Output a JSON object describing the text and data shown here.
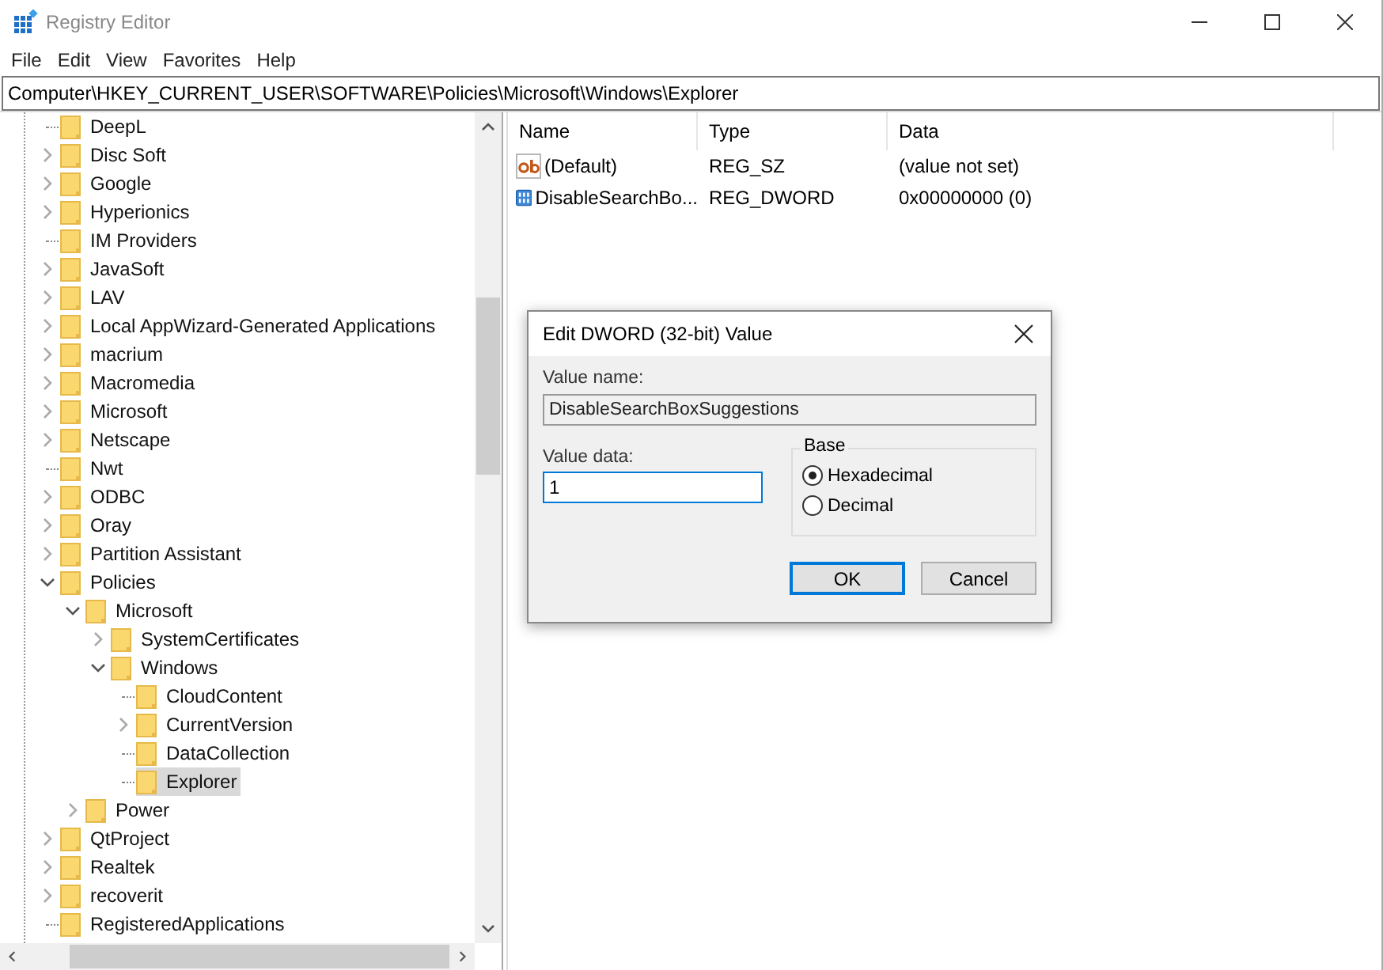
{
  "window": {
    "title": "Registry Editor"
  },
  "menu": [
    "File",
    "Edit",
    "View",
    "Favorites",
    "Help"
  ],
  "address": "Computer\\HKEY_CURRENT_USER\\SOFTWARE\\Policies\\Microsoft\\Windows\\Explorer",
  "tree": [
    {
      "label": "DeepL",
      "expandable": false,
      "selected": false
    },
    {
      "label": "Disc Soft",
      "expandable": true,
      "expanded": false,
      "selected": false
    },
    {
      "label": "Google",
      "expandable": true,
      "expanded": false,
      "selected": false
    },
    {
      "label": "Hyperionics",
      "expandable": true,
      "expanded": false,
      "selected": false
    },
    {
      "label": "IM Providers",
      "expandable": false,
      "selected": false
    },
    {
      "label": "JavaSoft",
      "expandable": true,
      "expanded": false,
      "selected": false
    },
    {
      "label": "LAV",
      "expandable": true,
      "expanded": false,
      "selected": false
    },
    {
      "label": "Local AppWizard-Generated Applications",
      "expandable": true,
      "expanded": false,
      "selected": false
    },
    {
      "label": "macrium",
      "expandable": true,
      "expanded": false,
      "selected": false
    },
    {
      "label": "Macromedia",
      "expandable": true,
      "expanded": false,
      "selected": false
    },
    {
      "label": "Microsoft",
      "expandable": true,
      "expanded": false,
      "selected": false
    },
    {
      "label": "Netscape",
      "expandable": true,
      "expanded": false,
      "selected": false
    },
    {
      "label": "Nwt",
      "expandable": false,
      "selected": false
    },
    {
      "label": "ODBC",
      "expandable": true,
      "expanded": false,
      "selected": false
    },
    {
      "label": "Oray",
      "expandable": true,
      "expanded": false,
      "selected": false
    },
    {
      "label": "Partition Assistant",
      "expandable": true,
      "expanded": false,
      "selected": false
    },
    {
      "label": "Policies",
      "expandable": true,
      "expanded": true,
      "selected": false,
      "children": [
        {
          "label": "Microsoft",
          "expandable": true,
          "expanded": true,
          "selected": false,
          "children": [
            {
              "label": "SystemCertificates",
              "expandable": true,
              "expanded": false,
              "selected": false
            },
            {
              "label": "Windows",
              "expandable": true,
              "expanded": true,
              "selected": false,
              "children": [
                {
                  "label": "CloudContent",
                  "expandable": false,
                  "selected": false
                },
                {
                  "label": "CurrentVersion",
                  "expandable": true,
                  "expanded": false,
                  "selected": false
                },
                {
                  "label": "DataCollection",
                  "expandable": false,
                  "selected": false
                },
                {
                  "label": "Explorer",
                  "expandable": false,
                  "selected": true
                }
              ]
            }
          ]
        },
        {
          "label": "Power",
          "expandable": true,
          "expanded": false,
          "selected": false
        }
      ]
    },
    {
      "label": "QtProject",
      "expandable": true,
      "expanded": false,
      "selected": false
    },
    {
      "label": "Realtek",
      "expandable": true,
      "expanded": false,
      "selected": false
    },
    {
      "label": "recoverit",
      "expandable": true,
      "expanded": false,
      "selected": false
    },
    {
      "label": "RegisteredApplications",
      "expandable": false,
      "selected": false
    }
  ],
  "values": {
    "columns": [
      "Name",
      "Type",
      "Data"
    ],
    "rows": [
      {
        "kind": "string",
        "name": "(Default)",
        "type": "REG_SZ",
        "data": "(value not set)"
      },
      {
        "kind": "binary",
        "name": "DisableSearchBo...",
        "type": "REG_DWORD",
        "data": "0x00000000 (0)"
      }
    ]
  },
  "dialog": {
    "title": "Edit DWORD (32-bit) Value",
    "value_name_label": "Value name:",
    "value_name": "DisableSearchBoxSuggestions",
    "value_data_label": "Value data:",
    "value_data": "1",
    "base_label": "Base",
    "bases": [
      {
        "label": "Hexadecimal",
        "selected": true
      },
      {
        "label": "Decimal",
        "selected": false
      }
    ],
    "buttons": [
      {
        "label": "OK",
        "default": true
      },
      {
        "label": "Cancel",
        "default": false
      }
    ]
  }
}
